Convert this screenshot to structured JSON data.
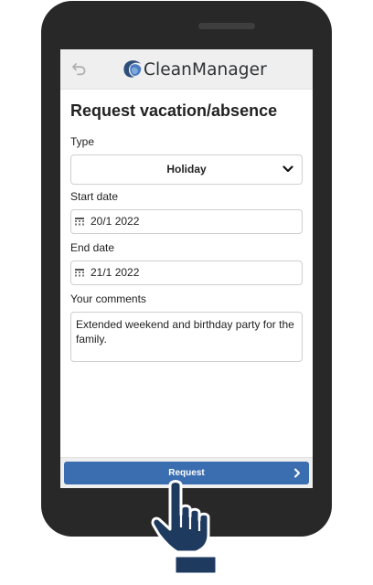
{
  "app": {
    "name": "CleanManager",
    "brand_color": "#3b6eb0",
    "back_icon": "undo-arrow-icon"
  },
  "page": {
    "title": "Request vacation/absence"
  },
  "form": {
    "type": {
      "label": "Type",
      "value": "Holiday",
      "icon": "chevron-down-icon"
    },
    "start_date": {
      "label": "Start date",
      "value": "20/1 2022",
      "icon": "calendar-icon"
    },
    "end_date": {
      "label": "End date",
      "value": "21/1 2022",
      "icon": "calendar-icon"
    },
    "comments": {
      "label": "Your comments",
      "value": "Extended weekend and birthday party for the family."
    }
  },
  "footer": {
    "request_label": "Request",
    "icon": "chevron-right-icon"
  },
  "overlay": {
    "icon": "pointing-hand-icon",
    "color": "#1e3a5f"
  }
}
